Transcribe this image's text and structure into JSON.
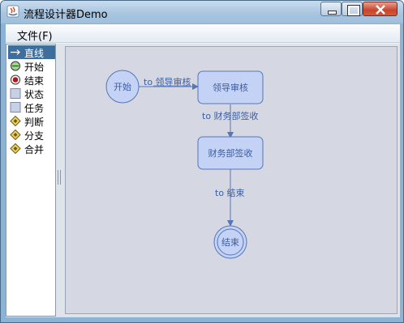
{
  "window": {
    "title": "流程设计器Demo"
  },
  "menu": {
    "file": "文件(F)"
  },
  "palette": [
    {
      "label": "直线",
      "icon": "arrow-line-icon",
      "selected": true
    },
    {
      "label": "开始",
      "icon": "start-circle-icon"
    },
    {
      "label": "结束",
      "icon": "end-circle-icon"
    },
    {
      "label": "状态",
      "icon": "state-box-icon"
    },
    {
      "label": "任务",
      "icon": "task-box-icon"
    },
    {
      "label": "判断",
      "icon": "decision-diamond-icon"
    },
    {
      "label": "分支",
      "icon": "fork-diamond-icon"
    },
    {
      "label": "合并",
      "icon": "join-diamond-icon"
    }
  ],
  "diagram": {
    "start": "开始",
    "review": "领导审核",
    "finance": "财务部签收",
    "end": "结束",
    "edge1": "to 领导审核",
    "edge2": "to 财务部签收",
    "edge3": "to 结束"
  },
  "colors": {
    "node_fill": "#c4d2f6",
    "node_stroke": "#5576b8",
    "edge": "#5576b8"
  }
}
